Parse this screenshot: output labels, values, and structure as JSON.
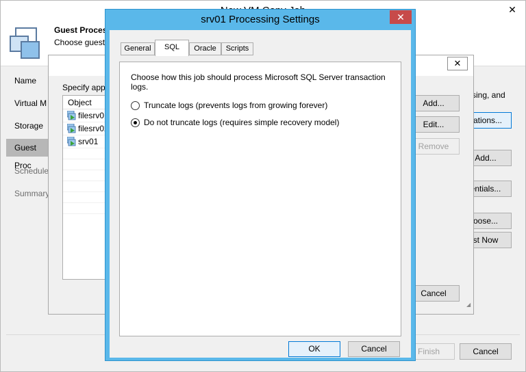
{
  "wizard": {
    "title": "New VM Copy Job",
    "close_glyph": "✕",
    "heading": "Guest Process",
    "subheading": "Choose guest",
    "nav": [
      "Name",
      "Virtual M",
      "Storage",
      "Guest Proc",
      "Schedule",
      "Summary"
    ],
    "right_text": "sing, and",
    "buttons": {
      "applications": "cations...",
      "add": "Add...",
      "credentials": "entials...",
      "choose": "oose...",
      "test_now": "st Now",
      "finish": "Finish",
      "cancel": "Cancel"
    }
  },
  "mid_dialog": {
    "close_glyph": "✕",
    "instruction": "Specify appl",
    "list_header": "Object",
    "items": [
      "filesrv01",
      "filesrv02",
      "srv01"
    ],
    "buttons": {
      "add": "Add...",
      "edit": "Edit...",
      "remove": "Remove",
      "cancel": "Cancel"
    }
  },
  "dialog": {
    "title": "srv01 Processing Settings",
    "close_glyph": "✕",
    "tabs": [
      "General",
      "SQL",
      "Oracle",
      "Scripts"
    ],
    "active_tab": "SQL",
    "description": "Choose how this job should process Microsoft SQL Server transaction logs.",
    "options": [
      {
        "label": "Truncate logs (prevents logs from growing forever)",
        "checked": false
      },
      {
        "label": "Do not truncate logs (requires simple recovery model)",
        "checked": true
      }
    ],
    "ok_label": "OK",
    "cancel_label": "Cancel"
  },
  "colors": {
    "accent": "#5ab8ea",
    "close_red": "#c74a4a",
    "focus_blue": "#0078d7"
  }
}
